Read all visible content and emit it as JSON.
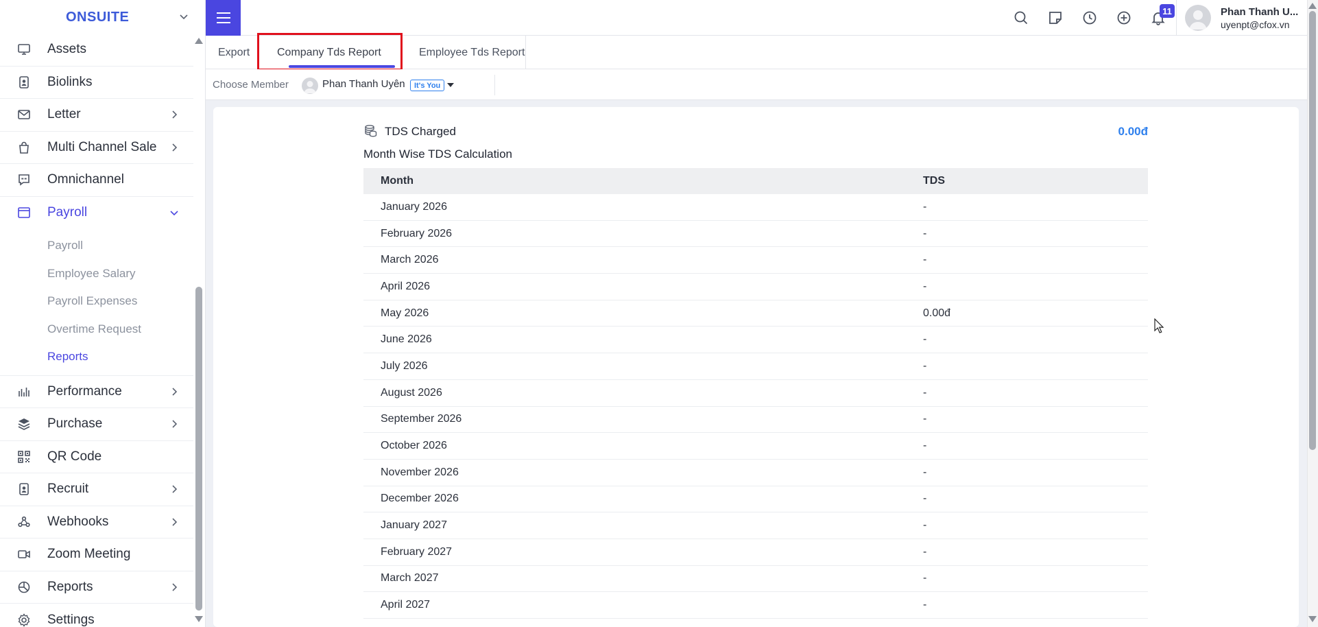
{
  "brand": {
    "name": "ONSUITE"
  },
  "sidebar": {
    "items": [
      {
        "label": "Assets",
        "icon": "monitor-icon",
        "has_children": false
      },
      {
        "label": "Biolinks",
        "icon": "id-badge-icon",
        "has_children": false
      },
      {
        "label": "Letter",
        "icon": "envelope-icon",
        "has_children": true
      },
      {
        "label": "Multi Channel Sale",
        "icon": "shopping-bag-icon",
        "has_children": true
      },
      {
        "label": "Omnichannel",
        "icon": "chat-bubble-icon",
        "has_children": false
      },
      {
        "label": "Payroll",
        "icon": "window-icon",
        "has_children": true,
        "expanded": true
      },
      {
        "label": "Performance",
        "icon": "bar-chart-icon",
        "has_children": true
      },
      {
        "label": "Purchase",
        "icon": "layers-icon",
        "has_children": true
      },
      {
        "label": "QR Code",
        "icon": "qr-code-icon",
        "has_children": false
      },
      {
        "label": "Recruit",
        "icon": "id-badge-icon",
        "has_children": true
      },
      {
        "label": "Webhooks",
        "icon": "webhook-icon",
        "has_children": true
      },
      {
        "label": "Zoom Meeting",
        "icon": "video-camera-icon",
        "has_children": false
      },
      {
        "label": "Reports",
        "icon": "pie-chart-icon",
        "has_children": true
      },
      {
        "label": "Settings",
        "icon": "gear-icon",
        "has_children": false
      }
    ],
    "payroll_sub": [
      {
        "label": "Payroll"
      },
      {
        "label": "Employee Salary"
      },
      {
        "label": "Payroll Expenses"
      },
      {
        "label": "Overtime Request"
      },
      {
        "label": "Reports",
        "active": true
      }
    ]
  },
  "topbar": {
    "notification_count": "11",
    "user_name": "Phan Thanh U...",
    "user_email": "uyenpt@cfox.vn"
  },
  "tabs": [
    {
      "label": "Export"
    },
    {
      "label": "Company Tds Report",
      "active": true
    },
    {
      "label": "Employee Tds Report"
    }
  ],
  "member": {
    "label": "Choose Member",
    "name": "Phan Thanh Uyên",
    "badge": "It's You"
  },
  "report": {
    "tds_title": "TDS Charged",
    "tds_total": "0.00đ",
    "section_title": "Month Wise TDS Calculation",
    "columns": [
      "Month",
      "TDS"
    ],
    "rows": [
      [
        "January 2026",
        "-"
      ],
      [
        "February 2026",
        "-"
      ],
      [
        "March 2026",
        "-"
      ],
      [
        "April 2026",
        "-"
      ],
      [
        "May 2026",
        "0.00đ"
      ],
      [
        "June 2026",
        "-"
      ],
      [
        "July 2026",
        "-"
      ],
      [
        "August 2026",
        "-"
      ],
      [
        "September 2026",
        "-"
      ],
      [
        "October 2026",
        "-"
      ],
      [
        "November 2026",
        "-"
      ],
      [
        "December 2026",
        "-"
      ],
      [
        "January 2027",
        "-"
      ],
      [
        "February 2027",
        "-"
      ],
      [
        "March 2027",
        "-"
      ],
      [
        "April 2027",
        "-"
      ]
    ]
  },
  "colors": {
    "accent": "#4a46e0",
    "brand": "#3d5bd9",
    "link": "#2f80ed",
    "highlight": "#e0101c"
  }
}
